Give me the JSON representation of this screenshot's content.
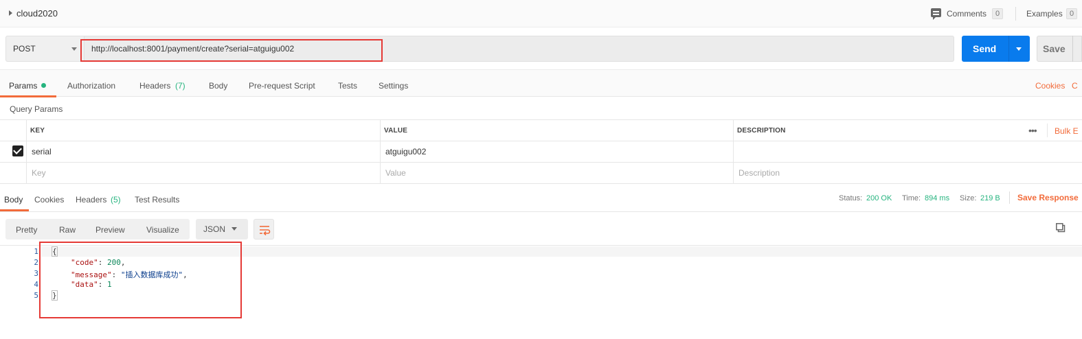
{
  "topbar": {
    "collection_name": "cloud2020",
    "comments_label": "Comments",
    "comments_count": "0",
    "examples_label": "Examples",
    "examples_count": "0"
  },
  "request": {
    "method": "POST",
    "url": "http://localhost:8001/payment/create?serial=atguigu002",
    "send_label": "Send",
    "save_label": "Save"
  },
  "request_tabs": {
    "params": "Params",
    "authorization": "Authorization",
    "headers": "Headers",
    "headers_count": "(7)",
    "body": "Body",
    "pre_request": "Pre-request Script",
    "tests": "Tests",
    "settings": "Settings",
    "cookies": "Cookies",
    "code_partial": "C"
  },
  "query_params": {
    "title": "Query Params",
    "columns": [
      "KEY",
      "VALUE",
      "DESCRIPTION"
    ],
    "bulk_edit": "Bulk E",
    "rows": [
      {
        "key": "serial",
        "value": "atguigu002",
        "description": ""
      }
    ],
    "placeholders": {
      "key": "Key",
      "value": "Value",
      "description": "Description"
    }
  },
  "response_tabs": {
    "body": "Body",
    "cookies": "Cookies",
    "headers": "Headers",
    "headers_count": "(5)",
    "test_results": "Test Results"
  },
  "response_status": {
    "status_label": "Status:",
    "status_value": "200 OK",
    "time_label": "Time:",
    "time_value": "894 ms",
    "size_label": "Size:",
    "size_value": "219 B",
    "save_response": "Save Response"
  },
  "format": {
    "pretty": "Pretty",
    "raw": "Raw",
    "preview": "Preview",
    "visualize": "Visualize",
    "language": "JSON"
  },
  "response_body": {
    "line_numbers": [
      "1",
      "2",
      "3",
      "4",
      "5"
    ],
    "open_brace": "{",
    "close_brace": "}",
    "fields": [
      {
        "key": "\"code\"",
        "value": "200",
        "type": "num",
        "trail": ","
      },
      {
        "key": "\"message\"",
        "value": "\"插入数据库成功\"",
        "type": "str",
        "trail": ","
      },
      {
        "key": "\"data\"",
        "value": "1",
        "type": "num",
        "trail": ""
      }
    ]
  },
  "colors": {
    "accent": "#f26b3a",
    "send_blue": "#097bed",
    "status_green": "#26b47f",
    "annotation_red": "#e53935"
  }
}
